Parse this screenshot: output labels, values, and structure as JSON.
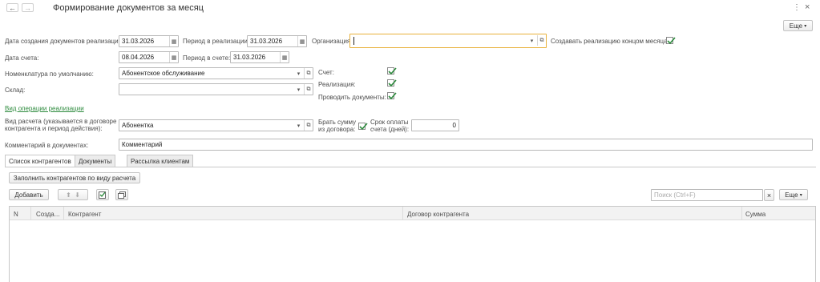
{
  "header": {
    "back_glyph": "←",
    "forward_glyph": "→",
    "title": "Формирование документов за месяц",
    "more_glyph": "⋮",
    "close_glyph": "×",
    "more_button": "Еще"
  },
  "form": {
    "doc_date_label": "Дата создания документов реализации:",
    "doc_date_value": "31.03.2026",
    "realization_period_label": "Период в реализации:",
    "realization_period_value": "31.03.2026",
    "organization_label": "Организация:",
    "organization_value": "",
    "create_at_month_end_label": "Создавать реализацию концом месяца:",
    "create_at_month_end_checked": true,
    "invoice_date_label": "Дата счета:",
    "invoice_date_value": "08.04.2026",
    "invoice_period_label": "Период в счете:",
    "invoice_period_value": "31.03.2026",
    "default_nomenclature_label": "Номенклатура по умолчанию:",
    "default_nomenclature_value": "Абонентское обслуживание",
    "warehouse_label": "Склад:",
    "warehouse_value": "",
    "invoice_check_label": "Счет:",
    "invoice_checked": true,
    "realization_check_label": "Реализация:",
    "realization_checked": true,
    "post_documents_label": "Проводить документы:",
    "post_documents_checked": true,
    "operation_type_link": "Вид операции реализации",
    "calc_type_label_line1": "Вид расчета (указывается в договоре",
    "calc_type_label_line2": "контрагента и период действия):",
    "calc_type_value": "Абонентка",
    "take_sum_label_line1": "Брать сумму",
    "take_sum_label_line2": "из договора:",
    "take_sum_checked": true,
    "payment_term_label_line1": "Срок оплаты",
    "payment_term_label_line2": "счета (дней):",
    "payment_term_value": "0",
    "comment_label": "Комментарий в документах:",
    "comment_value": "Комментарий"
  },
  "tabs": [
    {
      "label": "Список контрагентов",
      "active": true
    },
    {
      "label": "Документы",
      "active": false
    },
    {
      "label": "Рассылка клиентам",
      "active": false
    }
  ],
  "panel": {
    "fill_button": "Заполнить контрагентов по виду расчета",
    "add_button": "Добавить",
    "search_placeholder": "Поиск (Ctrl+F)",
    "search_clear_glyph": "×",
    "more_button": "Еще"
  },
  "table": {
    "columns": [
      "N",
      "Созда...",
      "Контрагент",
      "Договор контрагента",
      "Сумма"
    ],
    "rows": []
  }
}
